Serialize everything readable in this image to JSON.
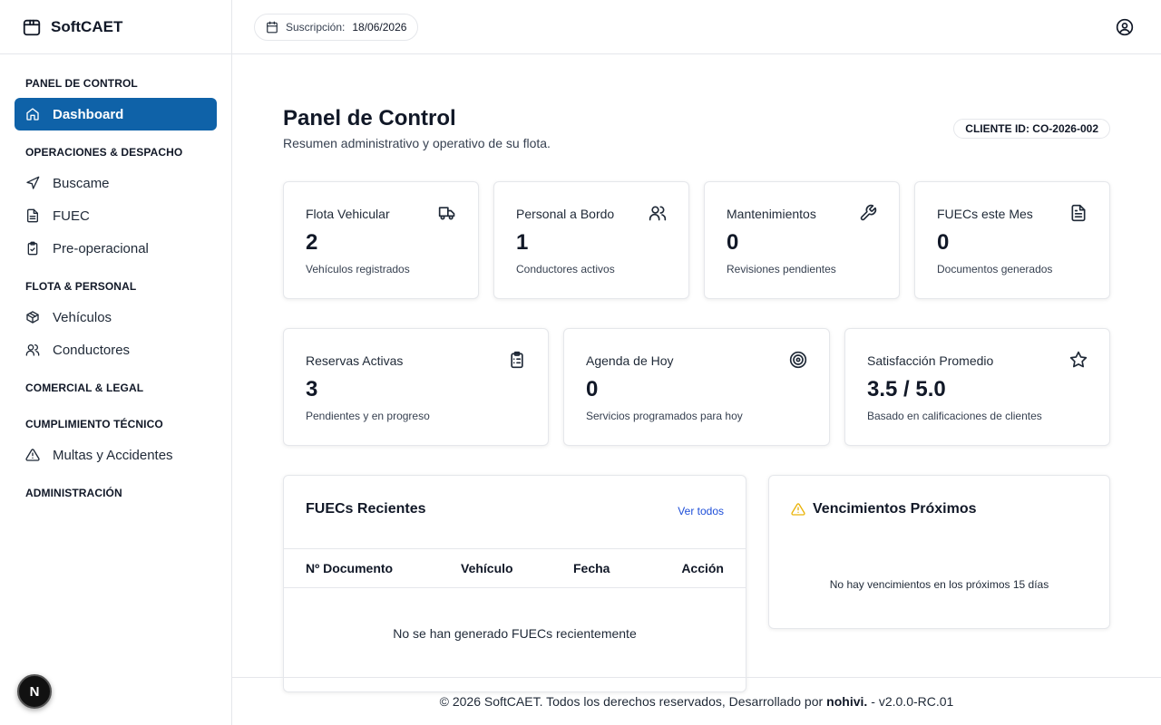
{
  "brand": {
    "name": "SoftCAET"
  },
  "sidebar": {
    "sections": {
      "panel": "PANEL DE CONTROL",
      "operaciones": "OPERACIONES & DESPACHO",
      "flota": "FLOTA & PERSONAL",
      "comercial": "COMERCIAL & LEGAL",
      "cumplimiento": "CUMPLIMIENTO TÉCNICO",
      "administracion": "ADMINISTRACIÓN"
    },
    "items": {
      "dashboard": "Dashboard",
      "buscame": "Buscame",
      "fuec": "FUEC",
      "preoperacional": "Pre-operacional",
      "vehiculos": "Vehículos",
      "conductores": "Conductores",
      "multas": "Multas y Accidentes"
    },
    "avatar_letter": "N",
    "accent_color": "#0f62a8"
  },
  "topbar": {
    "subscription_label": "Suscripción:",
    "subscription_date": "18/06/2026"
  },
  "page": {
    "title": "Panel de Control",
    "subtitle": "Resumen administrativo y operativo de su flota.",
    "client_id": "CLIENTE ID: CO-2026-002"
  },
  "stats": [
    {
      "title": "Flota Vehicular",
      "value": "2",
      "desc": "Vehículos registrados",
      "icon": "truck-icon"
    },
    {
      "title": "Personal a Bordo",
      "value": "1",
      "desc": "Conductores activos",
      "icon": "users-icon"
    },
    {
      "title": "Mantenimientos",
      "value": "0",
      "desc": "Revisiones pendientes",
      "icon": "wrench-icon"
    },
    {
      "title": "FUECs este Mes",
      "value": "0",
      "desc": "Documentos generados",
      "icon": "document-icon"
    },
    {
      "title": "Reservas Activas",
      "value": "3",
      "desc": "Pendientes y en progreso",
      "icon": "clipboard-list-icon"
    },
    {
      "title": "Agenda de Hoy",
      "value": "0",
      "desc": "Servicios programados para hoy",
      "icon": "target-icon"
    },
    {
      "title": "Satisfacción Promedio",
      "value": "3.5 / 5.0",
      "desc": "Basado en calificaciones de clientes",
      "icon": "star-icon"
    }
  ],
  "recent_fuecs": {
    "title": "FUECs Recientes",
    "see_all": "Ver todos",
    "columns": [
      "Nº Documento",
      "Vehículo",
      "Fecha",
      "Acción"
    ],
    "empty": "No se han generado FUECs recientemente"
  },
  "expirations": {
    "title": "Vencimientos Próximos",
    "empty": "No hay vencimientos en los próximos 15 días",
    "icon_color": "#eab308"
  },
  "footer": {
    "text": "© 2026 SoftCAET. Todos los derechos reservados, Desarrollado por",
    "author": "nohivi.",
    "version": "- v2.0.0-RC.01"
  }
}
